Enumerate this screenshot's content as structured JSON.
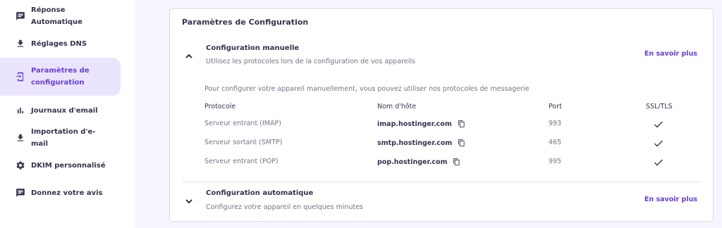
{
  "sidebar": {
    "items": [
      {
        "label": "Réponse Automatique",
        "icon": "chat-icon"
      },
      {
        "label": "Réglages DNS",
        "icon": "download-icon"
      },
      {
        "label": "Paramètres de configuration",
        "icon": "device-login-icon",
        "active": true
      },
      {
        "label": "Journaux d'email",
        "icon": "bar-chart-icon"
      },
      {
        "label": "Importation d'e-mail",
        "icon": "download-icon"
      },
      {
        "label": "DKIM personnalisé",
        "icon": "gear-icon"
      },
      {
        "label": "Donnez votre avis",
        "icon": "feedback-icon"
      }
    ]
  },
  "card": {
    "title": "Paramètres de Configuration",
    "manual": {
      "title": "Configuration manuelle",
      "subtitle": "Utilisez les protocoles lors de la configuration de vos appareils",
      "learn_more": "En savoir plus",
      "intro": "Pour configurer votre appareil manuellement, vous pouvez utiliser nos protocoles de messagerie",
      "headers": {
        "protocol": "Protocole",
        "host": "Nom d'hôte",
        "port": "Port",
        "ssl": "SSL/TLS"
      },
      "rows": [
        {
          "protocol": "Serveur entrant (IMAP)",
          "host": "imap.hostinger.com",
          "port": "993",
          "ssl": true
        },
        {
          "protocol": "Serveur sortant (SMTP)",
          "host": "smtp.hostinger.com",
          "port": "465",
          "ssl": true
        },
        {
          "protocol": "Serveur entrant (POP)",
          "host": "pop.hostinger.com",
          "port": "995",
          "ssl": true
        }
      ]
    },
    "auto": {
      "title": "Configuration automatique",
      "subtitle": "Configurez votre appareil en quelques minutes",
      "learn_more": "En savoir plus"
    }
  },
  "colors": {
    "accent": "#673de6",
    "active_bg": "#ebe4ff",
    "page_bg": "#f4f5ff",
    "text": "#36344d",
    "muted": "#727586"
  }
}
